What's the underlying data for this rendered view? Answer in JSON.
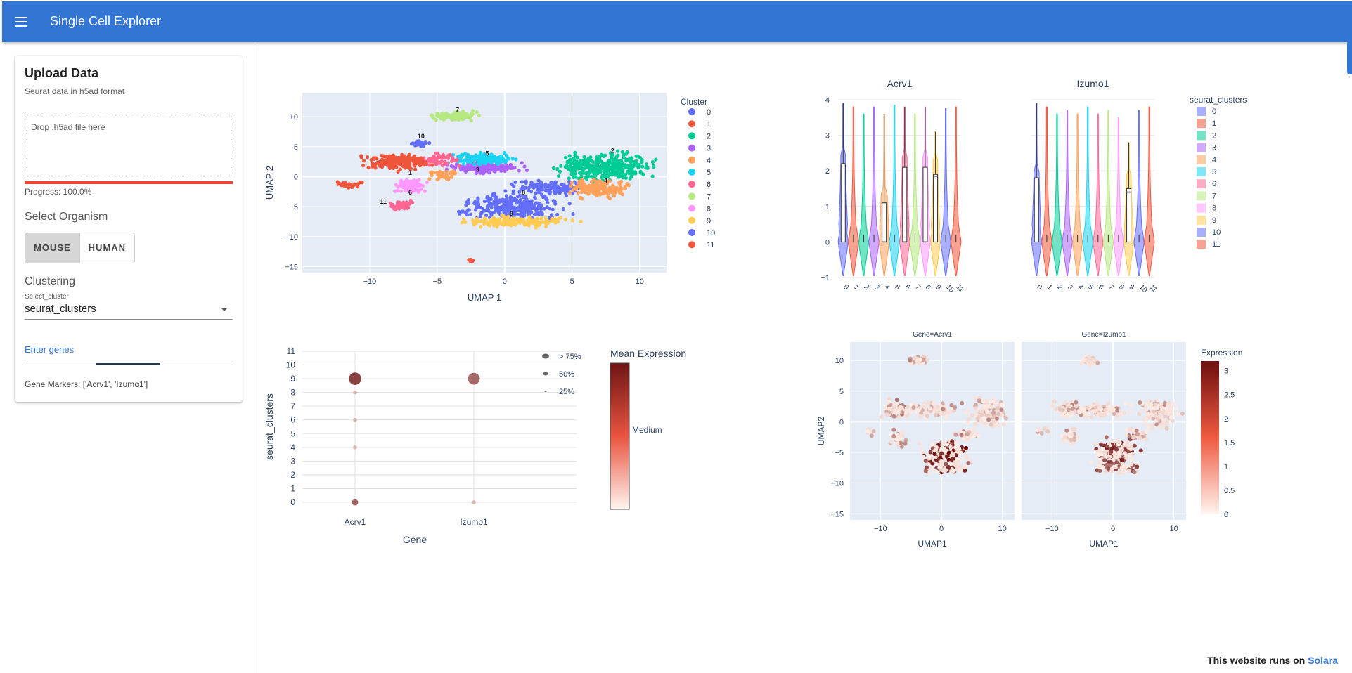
{
  "app": {
    "title": "Single Cell Explorer"
  },
  "upload": {
    "title": "Upload Data",
    "subtitle": "Seurat data in h5ad format",
    "dropzone": "Drop .h5ad file here",
    "progress": "Progress: 100.0%",
    "progress_value": 1.0
  },
  "organism": {
    "title": "Select Organism",
    "options": [
      "MOUSE",
      "HUMAN"
    ],
    "selected": "MOUSE"
  },
  "clustering": {
    "title": "Clustering",
    "select_label": "Select_cluster",
    "select_value": "seurat_clusters"
  },
  "genes": {
    "label": "Enter genes",
    "markers": "Gene Markers: ['Acrv1', 'Izumo1']"
  },
  "footer": {
    "prefix": "This website runs on",
    "link": "Solara"
  },
  "colors": {
    "appbar": "#3375d2",
    "accent": "#f44336"
  },
  "chart_data": [
    {
      "type": "scatter",
      "name": "umap",
      "xlabel": "UMAP 1",
      "ylabel": "UMAP 2",
      "xlim": [
        -15,
        12
      ],
      "ylim": [
        -16,
        14
      ],
      "xticks": [
        -10,
        -5,
        0,
        5,
        10
      ],
      "yticks": [
        -15,
        -10,
        -5,
        0,
        5,
        10
      ],
      "legend_title": "Cluster",
      "legend_entries": [
        "0",
        "1",
        "2",
        "3",
        "4",
        "5",
        "6",
        "7",
        "8",
        "9",
        "10",
        "11"
      ],
      "series_colors": [
        "#636efa",
        "#ef553b",
        "#00cc96",
        "#ab63fa",
        "#ffa15a",
        "#19d3f3",
        "#ff6692",
        "#b6e880",
        "#ff97ff",
        "#fecb52",
        "#636efa",
        "#ef553b"
      ],
      "cluster_labels": [
        {
          "label": "7",
          "x": -3.5,
          "y": 10.8
        },
        {
          "label": "10",
          "x": -6.2,
          "y": 6.4
        },
        {
          "label": "5",
          "x": -1.3,
          "y": 3.5
        },
        {
          "label": "3",
          "x": -2,
          "y": 0.8
        },
        {
          "label": "1",
          "x": -7,
          "y": 0.3
        },
        {
          "label": "6",
          "x": -7,
          "y": -3
        },
        {
          "label": "11",
          "x": -9,
          "y": -4.5
        },
        {
          "label": "8",
          "x": 1.4,
          "y": -3
        },
        {
          "label": "9",
          "x": 0.5,
          "y": -6.5
        },
        {
          "label": "2",
          "x": 8,
          "y": 4
        },
        {
          "label": "4",
          "x": 7.5,
          "y": -1
        }
      ]
    },
    {
      "type": "violin",
      "name": "violins",
      "panels": [
        "Acrv1",
        "Izumo1"
      ],
      "ylim": [
        -1,
        4
      ],
      "yticks": [
        -1,
        0,
        1,
        2,
        3,
        4
      ],
      "categories": [
        "0",
        "1",
        "2",
        "3",
        "4",
        "5",
        "6",
        "7",
        "8",
        "9",
        "10",
        "11"
      ],
      "legend_title": "seurat_clusters",
      "legend_entries": [
        "0",
        "1",
        "2",
        "3",
        "4",
        "5",
        "6",
        "7",
        "8",
        "9",
        "10",
        "11"
      ],
      "series_colors": [
        "#636efa",
        "#ef553b",
        "#00cc96",
        "#ab63fa",
        "#ffa15a",
        "#19d3f3",
        "#ff6692",
        "#b6e880",
        "#ff97ff",
        "#fecb52",
        "#636efa",
        "#ef553b"
      ],
      "medians": [
        [
          2.2,
          0,
          0,
          0,
          0,
          0,
          0,
          0,
          0,
          1.85,
          0,
          0
        ],
        [
          1.8,
          0,
          0,
          0,
          0,
          0,
          0,
          0,
          0,
          1.4,
          0,
          0
        ]
      ],
      "q3": [
        [
          2.2,
          0,
          0,
          0,
          1.1,
          0,
          2.1,
          0,
          2.1,
          1.9,
          0,
          0
        ],
        [
          1.8,
          0,
          0,
          0,
          0,
          0,
          0,
          0,
          0,
          1.5,
          0,
          0
        ]
      ],
      "maxes": [
        [
          3.9,
          3.8,
          3.6,
          3.8,
          3.6,
          3.85,
          3.8,
          3.6,
          3.8,
          3.1,
          3.75,
          3.8
        ],
        [
          3.9,
          3.8,
          3.6,
          3.7,
          3.6,
          3.8,
          3.6,
          3.7,
          3.5,
          2.8,
          3.7,
          3.8
        ]
      ]
    },
    {
      "type": "scatter",
      "name": "dotplot",
      "xlabel": "Gene",
      "ylabel": "seurat_clusters",
      "categories": [
        "Acrv1",
        "Izumo1"
      ],
      "yticks": [
        0,
        1,
        2,
        3,
        4,
        5,
        6,
        7,
        8,
        9,
        10,
        11
      ],
      "points": [
        {
          "gene": "Acrv1",
          "cluster": 9,
          "size": 0.85,
          "expression": 3.0
        },
        {
          "gene": "Izumo1",
          "cluster": 9,
          "size": 0.8,
          "expression": 2.3
        },
        {
          "gene": "Acrv1",
          "cluster": 0,
          "size": 0.3,
          "expression": 2.4
        },
        {
          "gene": "Acrv1",
          "cluster": 8,
          "size": 0.1,
          "expression": 1.0
        },
        {
          "gene": "Acrv1",
          "cluster": 6,
          "size": 0.1,
          "expression": 1.0
        },
        {
          "gene": "Acrv1",
          "cluster": 4,
          "size": 0.1,
          "expression": 0.9
        },
        {
          "gene": "Izumo1",
          "cluster": 0,
          "size": 0.1,
          "expression": 1.0
        }
      ],
      "size_legend": [
        "> 75%",
        "50%",
        "25%"
      ],
      "colorbar_title": "Mean Expression",
      "colorbar_label": "Medium"
    },
    {
      "type": "scatter",
      "name": "feature",
      "panels": [
        "Gene=Acrv1",
        "Gene=Izumo1"
      ],
      "xlabel": "UMAP1",
      "ylabel": "UMAP2",
      "xlim": [
        -15,
        12
      ],
      "ylim": [
        -16,
        13
      ],
      "xticks": [
        -10,
        0,
        10
      ],
      "yticks": [
        -15,
        -10,
        -5,
        0,
        5,
        10
      ],
      "colorbar_title": "Expression",
      "colorbar_ticks": [
        0,
        0.5,
        1,
        1.5,
        2,
        2.5,
        3
      ]
    }
  ]
}
